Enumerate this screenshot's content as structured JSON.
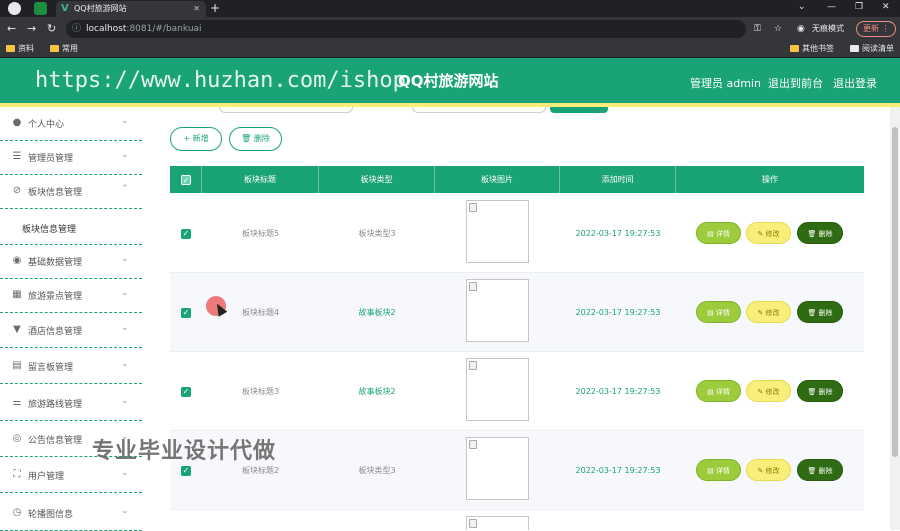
{
  "browser": {
    "tab_title": "QQ村旅游网站",
    "url_host": "localhost",
    "url_path": ":8081/#/bankuai",
    "incognito_label": "无痕模式",
    "update_label": "更新",
    "bookmarks": [
      "资料",
      "常用"
    ],
    "bookmarks_right": [
      "其他书签",
      "阅读清单"
    ]
  },
  "header": {
    "watermark_url": "https://www.huzhan.com/ishop",
    "title": "QQ村旅游网站",
    "admin_label": "管理员 admin",
    "back_label": "退出到前台",
    "logout_label": "退出登录"
  },
  "sidebar": {
    "items": [
      {
        "label": "个人中心",
        "icon": "user-icon"
      },
      {
        "label": "管理员管理",
        "icon": "list-icon"
      },
      {
        "label": "板块信息管理",
        "icon": "block-icon"
      },
      {
        "label": "板块信息管理",
        "icon": ""
      },
      {
        "label": "基础数据管理",
        "icon": "location-icon"
      },
      {
        "label": "旅游景点管理",
        "icon": "grid-icon"
      },
      {
        "label": "酒店信息管理",
        "icon": "trophy-icon"
      },
      {
        "label": "留言板管理",
        "icon": "print-icon"
      },
      {
        "label": "旅游路线管理",
        "icon": "sliders-icon"
      },
      {
        "label": "公告信息管理",
        "icon": "compass-icon"
      },
      {
        "label": "用户管理",
        "icon": "frame-icon"
      },
      {
        "label": "轮播图信息",
        "icon": "clock-icon"
      }
    ]
  },
  "toolbar": {
    "add_label": "新增",
    "delete_label": "删除"
  },
  "table": {
    "headers": [
      "板块标题",
      "板块类型",
      "板块图片",
      "添加时间",
      "操作"
    ],
    "rows": [
      {
        "title": "板块标题5",
        "type": "板块类型3",
        "time": "2022-03-17 19:27:53"
      },
      {
        "title": "板块标题4",
        "type": "故事板块2",
        "time": "2022-03-17 19:27:53"
      },
      {
        "title": "板块标题3",
        "type": "故事板块2",
        "time": "2022-03-17 19:27:53"
      },
      {
        "title": "板块标题2",
        "type": "板块类型3",
        "time": "2022-03-17 19:27:53"
      }
    ],
    "ops": {
      "detail": "详情",
      "edit": "修改",
      "delete": "删除"
    }
  },
  "overlay": {
    "watermark_text": "专业毕业设计代做"
  },
  "colors": {
    "primary": "#1aa377",
    "accent_yellow": "#f7ef7a",
    "detail_btn": "#9ccc3c",
    "delete_btn": "#2e6b12"
  }
}
